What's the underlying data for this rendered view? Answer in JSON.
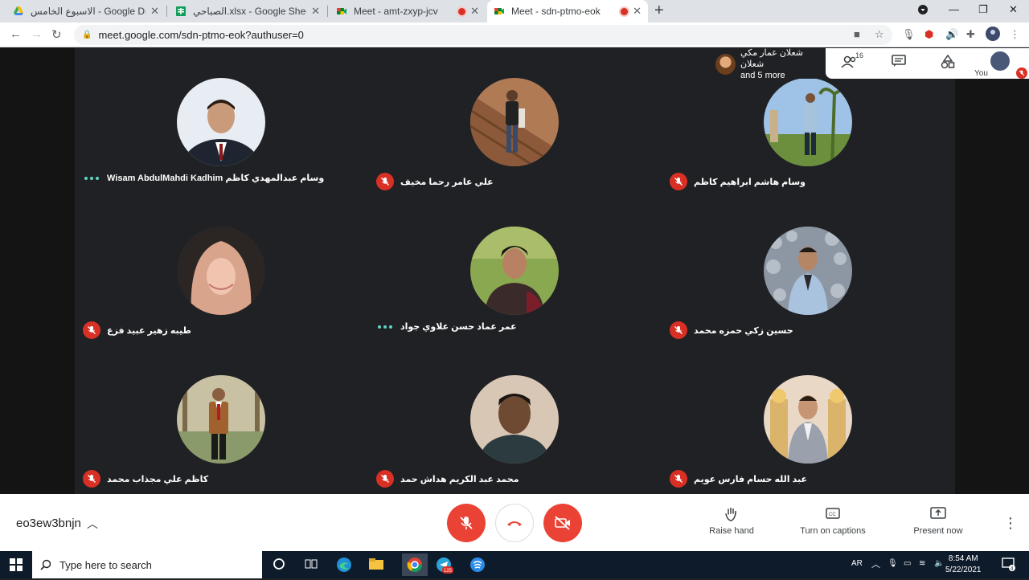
{
  "browser": {
    "tabs": [
      {
        "title": "الاسبوع الخامس - Google Drive",
        "icon": "google-drive-icon"
      },
      {
        "title": "الصباحي.xlsx - Google Sheets",
        "icon": "google-sheets-icon"
      },
      {
        "title": "Meet - amt-zxyp-jcv",
        "icon": "google-meet-icon"
      },
      {
        "title": "Meet - sdn-ptmo-eok",
        "icon": "google-meet-icon"
      }
    ],
    "url": "meet.google.com/sdn-ptmo-eok?authuser=0"
  },
  "meet": {
    "active_speaker": {
      "line1": "شعلان عمار مكي شعلان",
      "line2": "and 5 more"
    },
    "participant_count": "16",
    "self_label": "You",
    "participants": [
      {
        "name": "Wisam AbdulMahdi Kadhim وسام عبدالمهدي كاظم",
        "status": "speaking"
      },
      {
        "name": "علي عامر رحما مخيف",
        "status": "muted"
      },
      {
        "name": "وسام هاشم ابراهيم كاظم",
        "status": "muted"
      },
      {
        "name": "طيبه زهير عبيد فزع",
        "status": "muted"
      },
      {
        "name": "عمر عماد حسن علاوي جواد",
        "status": "speaking"
      },
      {
        "name": "حسين زكي حمزه محمد",
        "status": "muted"
      },
      {
        "name": "كاظم علي مجذاب محمد",
        "status": "muted"
      },
      {
        "name": "محمد عبد الكريم هداش حمد",
        "status": "muted"
      },
      {
        "name": "عبد الله حسام فارس عويم",
        "status": "muted"
      }
    ],
    "meeting_code": "eo3ew3bnjn",
    "actions": {
      "raise_hand": "Raise hand",
      "captions": "Turn on captions",
      "present": "Present now"
    }
  },
  "taskbar": {
    "search_placeholder": "Type here to search",
    "language": "AR",
    "time": "8:54 AM",
    "date": "5/22/2021",
    "notification_count": "4",
    "telegram_badge": "125"
  },
  "colors": {
    "accent_red": "#ea4335",
    "meet_bg": "#202124",
    "speaking_dots": "#5fd6c2"
  }
}
